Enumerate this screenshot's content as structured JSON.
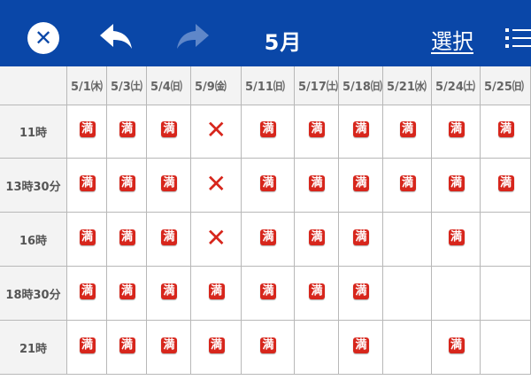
{
  "header": {
    "title": "5月",
    "select_label": "選択",
    "colors": {
      "bar": "#0a47a8",
      "text": "#ffffff"
    },
    "icons": [
      "close-icon",
      "undo-icon",
      "redo-icon",
      "list-icon"
    ]
  },
  "grid": {
    "columns": [
      "5/1㈭",
      "5/3㈯",
      "5/4㈰",
      "5/9㈮",
      "5/11㈰",
      "5/17㈯",
      "5/18㈰",
      "5/21㈬",
      "5/24㈯",
      "5/25㈰"
    ],
    "rows": [
      {
        "label": "11時",
        "cells": [
          "満",
          "満",
          "満",
          "×",
          "満",
          "満",
          "満",
          "満",
          "満",
          "満"
        ]
      },
      {
        "label": "13時30分",
        "cells": [
          "満",
          "満",
          "満",
          "×",
          "満",
          "満",
          "満",
          "満",
          "満",
          "満"
        ]
      },
      {
        "label": "16時",
        "cells": [
          "満",
          "満",
          "満",
          "×",
          "満",
          "満",
          "満",
          "",
          "満",
          ""
        ]
      },
      {
        "label": "18時30分",
        "cells": [
          "満",
          "満",
          "満",
          "満",
          "満",
          "満",
          "満",
          "",
          "",
          ""
        ]
      },
      {
        "label": "21時",
        "cells": [
          "満",
          "満",
          "満",
          "満",
          "満",
          "",
          "満",
          "",
          "満",
          ""
        ]
      }
    ],
    "colors": {
      "full": "#d7261c",
      "cross": "#d7261c",
      "header_bg": "#f3f3f3",
      "border": "#b8b8b8"
    }
  }
}
